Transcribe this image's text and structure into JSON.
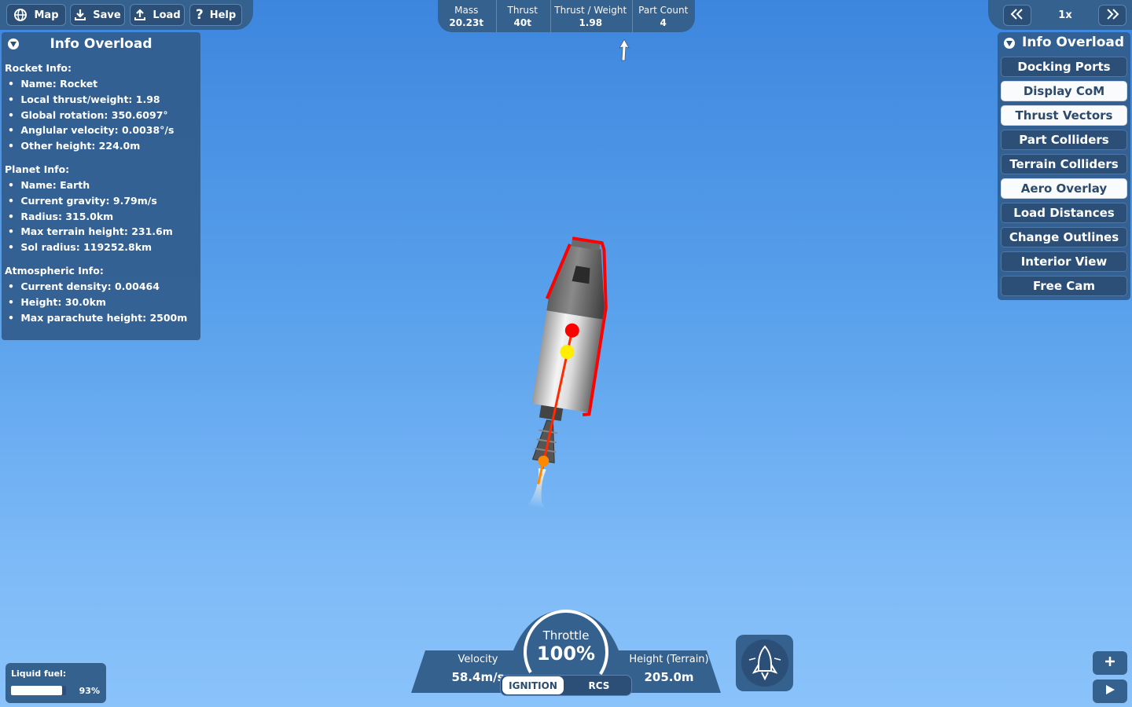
{
  "toolbar": {
    "map_label": "Map",
    "save_label": "Save",
    "load_label": "Load",
    "help_label": "Help"
  },
  "stats": [
    {
      "label": "Mass",
      "value": "20.23t"
    },
    {
      "label": "Thrust",
      "value": "40t"
    },
    {
      "label": "Thrust / Weight",
      "value": "1.98"
    },
    {
      "label": "Part Count",
      "value": "4"
    }
  ],
  "time_controls": {
    "scale": "1x"
  },
  "info_panel": {
    "title": "Info Overload",
    "sections": [
      {
        "title": "Rocket Info:",
        "items": [
          "Name: Rocket",
          "Local thrust/weight: 1.98",
          "Global rotation: 350.6097°",
          "Anglular velocity: 0.0038°/s",
          "Other height: 224.0m"
        ]
      },
      {
        "title": "Planet Info:",
        "items": [
          "Name: Earth",
          "Current gravity: 9.79m/s",
          "Radius: 315.0km",
          "Max terrain height: 231.6m",
          "Sol radius: 119252.8km"
        ]
      },
      {
        "title": "Atmospheric Info:",
        "items": [
          "Current density: 0.00464",
          "Height: 30.0km",
          "Max parachute height: 2500m"
        ]
      }
    ]
  },
  "overlay_panel": {
    "title": "Info Overload",
    "buttons": [
      {
        "label": "Docking Ports",
        "active": false
      },
      {
        "label": "Display CoM",
        "active": true
      },
      {
        "label": "Thrust Vectors",
        "active": true
      },
      {
        "label": "Part Colliders",
        "active": false
      },
      {
        "label": "Terrain Colliders",
        "active": false
      },
      {
        "label": "Aero Overlay",
        "active": true
      },
      {
        "label": "Load Distances",
        "active": false
      },
      {
        "label": "Change Outlines",
        "active": false
      },
      {
        "label": "Interior View",
        "active": false
      },
      {
        "label": "Free Cam",
        "active": false
      }
    ]
  },
  "hud": {
    "velocity_label": "Velocity",
    "velocity_value": "58.4m/s",
    "throttle_label": "Throttle",
    "throttle_value": "100%",
    "throttle_fraction": 1.0,
    "height_label": "Height (Terrain)",
    "height_value": "205.0m",
    "ignition_label": "IGNITION",
    "rcs_label": "RCS"
  },
  "fuel": {
    "label": "Liquid fuel:",
    "percent_text": "93%",
    "fraction": 0.93
  },
  "colors": {
    "panel": "#35618e",
    "button": "#2c4f78",
    "active_button": "#fafbfc",
    "com_marker": "#ff0000",
    "col_marker": "#ffee00",
    "thrust_marker": "#ff8800",
    "outline": "#ff0000"
  },
  "icons": {
    "map": "globe-icon",
    "save": "download-icon",
    "load": "upload-icon",
    "help": "question-icon",
    "rewind": "double-chevron-left-icon",
    "fast_forward": "double-chevron-right-icon",
    "stage": "rocket-icon",
    "zoom_in": "plus-icon",
    "play": "play-icon"
  }
}
